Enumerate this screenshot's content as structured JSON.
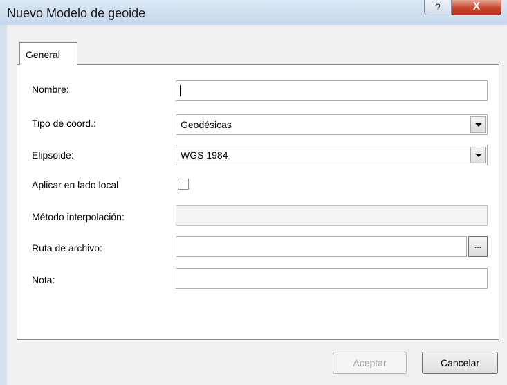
{
  "window": {
    "title": "Nuevo Modelo de geoide",
    "help_label": "?",
    "close_label": "X"
  },
  "tabs": [
    {
      "label": "General"
    }
  ],
  "form": {
    "nombre": {
      "label": "Nombre:",
      "value": ""
    },
    "tipo_coord": {
      "label": "Tipo de coord.:",
      "value": "Geodésicas"
    },
    "elipsoide": {
      "label": "Elipsoide:",
      "value": "WGS 1984"
    },
    "aplicar_lado_local": {
      "label": "Aplicar en lado local",
      "checked": false
    },
    "metodo_interpolacion": {
      "label": "Método interpolación:",
      "value": "",
      "disabled": true
    },
    "ruta_archivo": {
      "label": "Ruta de archivo:",
      "value": "",
      "browse_label": "..."
    },
    "nota": {
      "label": "Nota:",
      "value": ""
    }
  },
  "buttons": {
    "accept_label": "Aceptar",
    "accept_disabled": true,
    "cancel_label": "Cancelar"
  }
}
